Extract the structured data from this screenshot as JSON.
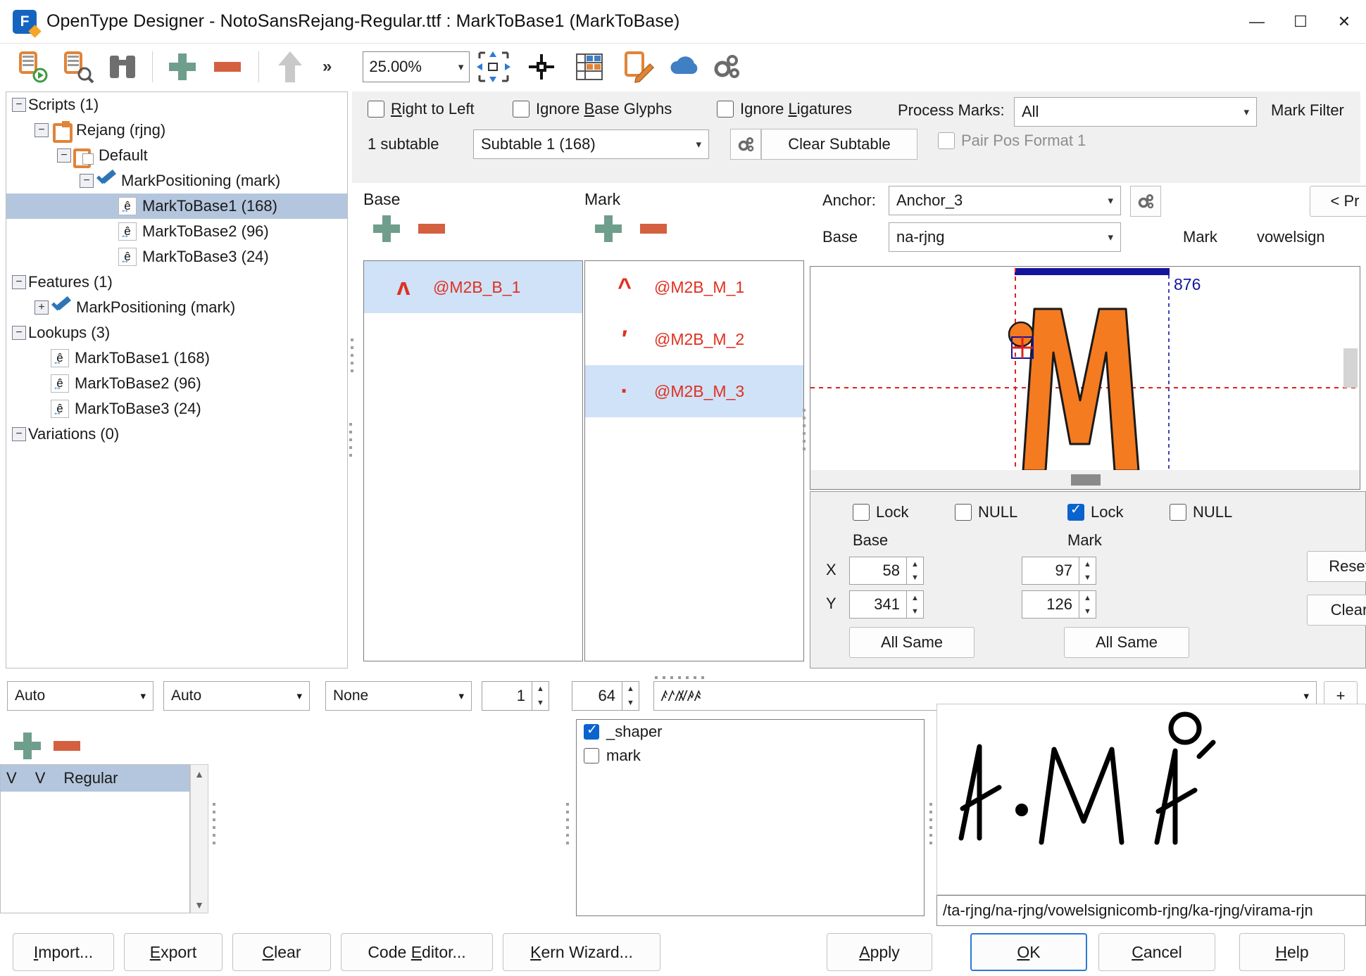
{
  "window": {
    "title": "OpenType Designer - NotoSansRejang-Regular.ttf : MarkToBase1 (MarkToBase)",
    "logo_letter": "F",
    "minimize": "—",
    "maximize": "☐",
    "close": "✕"
  },
  "toolbar": {
    "overflow_chevron": "»",
    "zoom_value": "25.00%",
    "icons": [
      "open-font-icon",
      "inspect-font-icon",
      "binoculars-icon",
      "add-icon",
      "remove-icon",
      "up-arrow-icon",
      "fit-to-window-icon",
      "center-anchor-icon",
      "table-view-icon",
      "edit-glyph-icon",
      "cloud-icon",
      "settings-gear-icon"
    ]
  },
  "tree": {
    "nodes": [
      {
        "label": "Scripts (1)",
        "indent": 0,
        "toggle": "−",
        "icon": "none",
        "selected": false
      },
      {
        "label": "Rejang (rjng)",
        "indent": 1,
        "toggle": "−",
        "icon": "scroll",
        "selected": false
      },
      {
        "label": "Default",
        "indent": 2,
        "toggle": "−",
        "icon": "scroll-list",
        "selected": false
      },
      {
        "label": "MarkPositioning (mark)",
        "indent": 3,
        "toggle": "−",
        "icon": "check",
        "selected": false
      },
      {
        "label": "MarkToBase1 (168)",
        "indent": 4,
        "toggle": "none",
        "icon": "ehat",
        "selected": true
      },
      {
        "label": "MarkToBase2 (96)",
        "indent": 4,
        "toggle": "none",
        "icon": "ehat",
        "selected": false
      },
      {
        "label": "MarkToBase3 (24)",
        "indent": 4,
        "toggle": "none",
        "icon": "ehat",
        "selected": false
      },
      {
        "label": "Features (1)",
        "indent": 0,
        "toggle": "−",
        "icon": "none",
        "selected": false
      },
      {
        "label": "MarkPositioning (mark)",
        "indent": 1,
        "toggle": "+",
        "icon": "check",
        "selected": false
      },
      {
        "label": "Lookups (3)",
        "indent": 0,
        "toggle": "−",
        "icon": "none",
        "selected": false
      },
      {
        "label": "MarkToBase1 (168)",
        "indent": 1,
        "toggle": "none",
        "icon": "ehat",
        "selected": false
      },
      {
        "label": "MarkToBase2 (96)",
        "indent": 1,
        "toggle": "none",
        "icon": "ehat",
        "selected": false
      },
      {
        "label": "MarkToBase3 (24)",
        "indent": 1,
        "toggle": "none",
        "icon": "ehat",
        "selected": false
      },
      {
        "label": "Variations (0)",
        "indent": 0,
        "toggle": "−",
        "icon": "none",
        "selected": false
      }
    ]
  },
  "options": {
    "right_to_left": {
      "label_pre": "",
      "label_u": "R",
      "label_post": "ight to Left",
      "checked": false
    },
    "ignore_base_glyphs": {
      "label_pre": "Ignore ",
      "label_u": "B",
      "label_post": "ase Glyphs",
      "checked": false
    },
    "ignore_ligatures": {
      "label_pre": "Ignore ",
      "label_u": "L",
      "label_post": "igatures",
      "checked": false
    },
    "process_marks_label": "Process Marks:",
    "process_marks_value": "All",
    "mark_filter_label": "Mark Filter",
    "subtable_count": "1 subtable",
    "subtable_value": "Subtable 1 (168)",
    "clear_subtable": "Clear Subtable",
    "pair_pos_format": {
      "label": "Pair Pos Format 1",
      "checked": false
    }
  },
  "glyph_lists": {
    "base_header": "Base",
    "mark_header": "Mark",
    "base_rows": [
      {
        "glyph": "ʌ",
        "name": "@M2B_B_1",
        "selected": true
      }
    ],
    "mark_rows": [
      {
        "glyph": "^",
        "name": "@M2B_M_1",
        "selected": false
      },
      {
        "glyph": "′",
        "name": "@M2B_M_2",
        "selected": false
      },
      {
        "glyph": "·",
        "name": "@M2B_M_3",
        "selected": true
      }
    ]
  },
  "anchor": {
    "anchor_label": "Anchor:",
    "anchor_value": "Anchor_3",
    "base_label": "Base",
    "base_value": "na-rjng",
    "mark_label": "Mark",
    "mark_value": "vowelsign",
    "prev_button": "< Pr"
  },
  "canvas": {
    "advance_width": "876"
  },
  "coords": {
    "base_lock": {
      "label": "Lock",
      "checked": false
    },
    "base_null": {
      "label": "NULL",
      "checked": false
    },
    "mark_lock": {
      "label": "Lock",
      "checked": true
    },
    "mark_null": {
      "label": "NULL",
      "checked": false
    },
    "base_col_label": "Base",
    "mark_col_label": "Mark",
    "x_label": "X",
    "y_label": "Y",
    "base_x": "58",
    "base_y": "341",
    "mark_x": "97",
    "mark_y": "126",
    "base_all_same": "All Same",
    "mark_all_same": "All Same",
    "reset_button": "Reset",
    "clear_button": "Clear"
  },
  "bottom_bar": {
    "combo1": "Auto",
    "combo2": "Auto",
    "combo3": "None",
    "spin1": "1",
    "spin2": "64",
    "text_value": "ꤰꤱꤲꤳꤴ",
    "add_button": "+"
  },
  "instances": {
    "row_cols": [
      "V",
      "V",
      "Regular"
    ]
  },
  "features": {
    "items": [
      {
        "label": "_shaper",
        "checked": true
      },
      {
        "label": "mark",
        "checked": false
      }
    ]
  },
  "preview": {
    "glyph_string": "ʌ·MÅ",
    "path_text": "/ta-rjng/na-rjng/vowelsignicomb-rjng/ka-rjng/virama-rjn"
  },
  "buttons": {
    "import": {
      "pre": "",
      "u": "I",
      "post": "mport..."
    },
    "export": {
      "pre": "",
      "u": "E",
      "post": "xport"
    },
    "clear": {
      "pre": "",
      "u": "C",
      "post": "lear"
    },
    "code_editor": {
      "pre": "Code ",
      "u": "E",
      "post": "ditor..."
    },
    "kern_wizard": {
      "pre": "",
      "u": "K",
      "post": "ern Wizard..."
    },
    "apply": {
      "pre": "",
      "u": "A",
      "post": "pply"
    },
    "ok": {
      "pre": "",
      "u": "O",
      "post": "K"
    },
    "cancel": {
      "pre": "",
      "u": "C",
      "post": "ancel"
    },
    "help": {
      "pre": "",
      "u": "H",
      "post": "elp"
    }
  }
}
